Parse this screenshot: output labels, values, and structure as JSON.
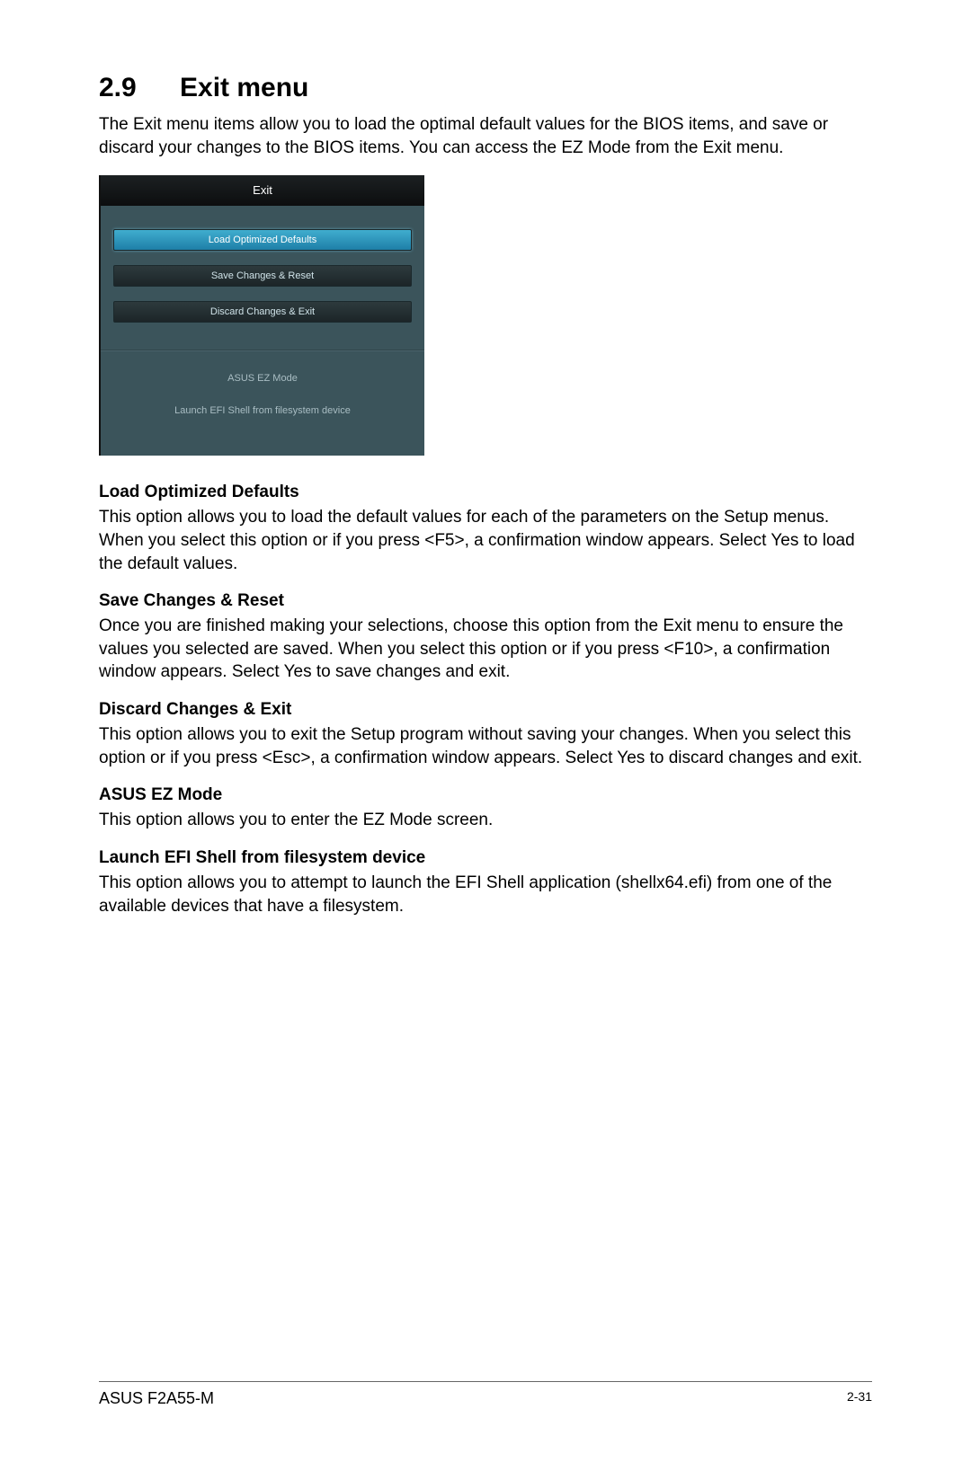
{
  "heading": {
    "number": "2.9",
    "title": "Exit menu"
  },
  "intro": "The Exit menu items allow you to load the optimal default values for the BIOS items, and save or discard your changes to the BIOS items. You can access the EZ Mode from the Exit menu.",
  "bios": {
    "tab": "Exit",
    "items": [
      "Load Optimized Defaults",
      "Save Changes & Reset",
      "Discard Changes & Exit"
    ],
    "links": [
      "ASUS EZ Mode",
      "Launch EFI Shell from filesystem device"
    ]
  },
  "sections": [
    {
      "title": "Load Optimized Defaults",
      "body": "This option allows you to load the default values for each of the parameters on the Setup menus. When you select this option or if you press <F5>, a confirmation window appears. Select Yes to load the default values."
    },
    {
      "title": "Save Changes & Reset",
      "body": "Once you are finished making your selections, choose this option from the Exit menu to ensure the values you selected are saved. When you select this option or if you press <F10>, a confirmation window appears. Select Yes to save changes and exit."
    },
    {
      "title": "Discard Changes & Exit",
      "body": "This option allows you to exit the Setup program without saving your changes. When you select this option or if you press <Esc>, a confirmation window appears. Select Yes to discard changes and exit."
    },
    {
      "title": "ASUS EZ Mode",
      "body": "This option allows you to enter the EZ Mode screen."
    },
    {
      "title": "Launch EFI Shell from filesystem device",
      "body": "This option allows you to attempt to launch the EFI Shell application (shellx64.efi) from one of the available devices that have a filesystem."
    }
  ],
  "footer": {
    "model": "ASUS F2A55-M",
    "page": "2-31"
  }
}
